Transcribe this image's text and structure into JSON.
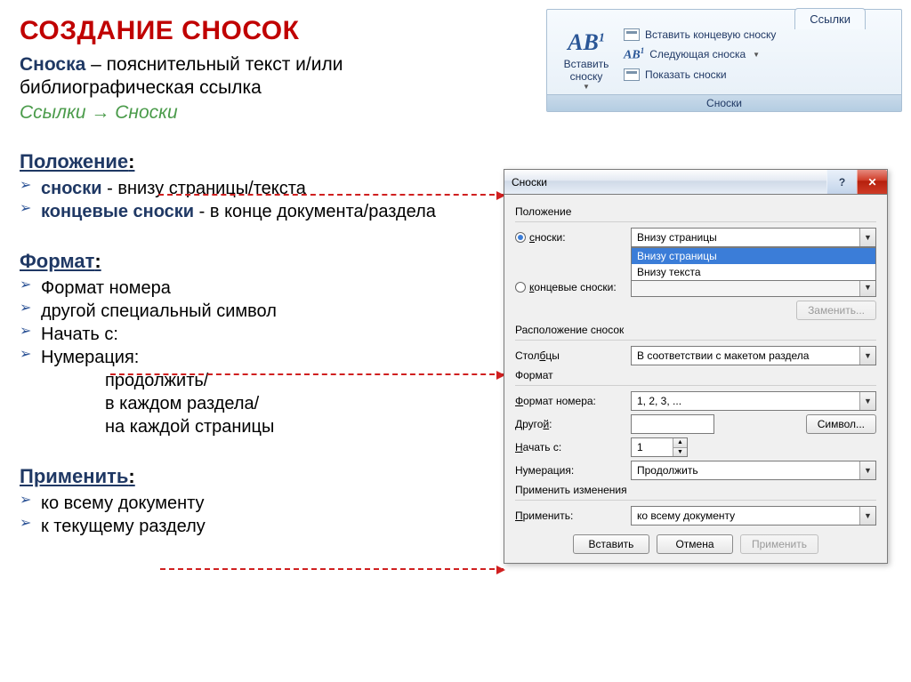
{
  "title": "СОЗДАНИЕ СНОСОК",
  "definition": {
    "term": "Сноска",
    "dash": " – ",
    "text": "пояснительный текст и/или библиографическая ссылка"
  },
  "path": "Ссылки → Сноски",
  "sections": {
    "position": {
      "title": "Положение",
      "items": [
        {
          "kw": "сноски",
          "rest": " - внизу страницы/текста"
        },
        {
          "kw": "концевые сноски",
          "rest": " - в конце документа/раздела"
        }
      ]
    },
    "format": {
      "title": "Формат",
      "items": [
        "Формат номера",
        "другой специальный символ",
        "Начать с:",
        "Нумерация:"
      ],
      "sub": [
        "продолжить/",
        "в каждом раздела/",
        "на каждой страницы"
      ]
    },
    "apply": {
      "title": "Применить",
      "items": [
        "ко всему документу",
        "к текущему разделу"
      ]
    }
  },
  "ribbon": {
    "tab": "Ссылки",
    "big_button": "Вставить сноску",
    "items": [
      "Вставить концевую сноску",
      "Следующая сноска",
      "Показать сноски"
    ],
    "group_title": "Сноски"
  },
  "dialog": {
    "title": "Сноски",
    "groups": {
      "position": "Положение",
      "layout": "Расположение сносок",
      "format": "Формат",
      "apply": "Применить изменения"
    },
    "labels": {
      "footnotes": "сноски:",
      "endnotes": "концевые сноски:",
      "columns": "Столбцы",
      "num_format": "Формат номера:",
      "other": "Другой:",
      "start_at": "Начать с:",
      "numbering": "Нумерация:",
      "apply_to": "Применить:"
    },
    "values": {
      "footnotes": "Внизу страницы",
      "dropdown": [
        "Внизу страницы",
        "Внизу текста"
      ],
      "columns": "В соответствии с макетом раздела",
      "num_format": "1, 2, 3, ...",
      "other": "",
      "start_at": "1",
      "numbering": "Продолжить",
      "apply_to": "ко всему документу"
    },
    "buttons": {
      "replace": "Заменить...",
      "symbol": "Символ...",
      "insert": "Вставить",
      "cancel": "Отмена",
      "apply": "Применить"
    }
  }
}
